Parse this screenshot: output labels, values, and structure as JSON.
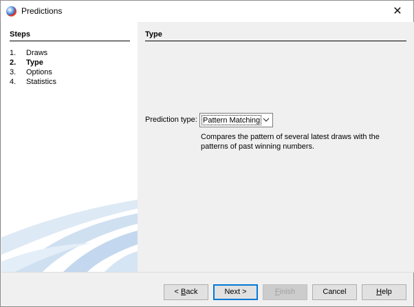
{
  "window": {
    "title": "Predictions",
    "close_glyph": "✕",
    "icon": "app-orb-icon"
  },
  "steps": {
    "heading": "Steps",
    "items": [
      {
        "num": "1.",
        "label": "Draws",
        "current": false
      },
      {
        "num": "2.",
        "label": "Type",
        "current": true
      },
      {
        "num": "3.",
        "label": "Options",
        "current": false
      },
      {
        "num": "4.",
        "label": "Statistics",
        "current": false
      }
    ]
  },
  "content": {
    "heading": "Type",
    "prediction_type_label": "Prediction type:",
    "prediction_type_value": "Pattern Matching",
    "description": "Compares the pattern of several latest draws with the patterns of past winning numbers."
  },
  "buttons": {
    "back": {
      "prefix": "< ",
      "mnemonic": "B",
      "rest": "ack"
    },
    "next": "Next >",
    "finish": {
      "mnemonic": "F",
      "rest": "inish"
    },
    "cancel": "Cancel",
    "help": {
      "mnemonic": "H",
      "rest": "elp"
    }
  },
  "colors": {
    "accent": "#0078d7",
    "panel_bg": "#f0f0f0",
    "swoosh": "#c9dcee"
  }
}
